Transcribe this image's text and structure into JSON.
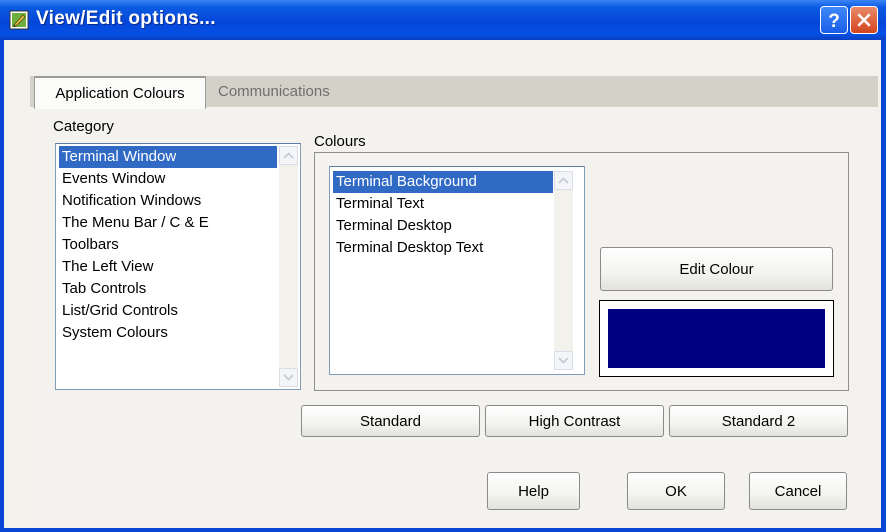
{
  "window": {
    "title": "View/Edit options..."
  },
  "tabs": [
    {
      "label": "Application Colours",
      "active": true
    },
    {
      "label": "Communications",
      "active": false
    }
  ],
  "category": {
    "label": "Category",
    "items": [
      "Terminal Window",
      "Events Window",
      "Notification Windows",
      "The Menu Bar / C & E",
      "Toolbars",
      "The Left View",
      "Tab Controls",
      "List/Grid Controls",
      "System Colours"
    ],
    "selected_index": 0
  },
  "colours": {
    "label": "Colours",
    "items": [
      "Terminal Background",
      "Terminal Text",
      "Terminal Desktop",
      "Terminal Desktop Text"
    ],
    "selected_index": 0,
    "edit_button": "Edit Colour",
    "preview_color": "#000080"
  },
  "schemes": {
    "standard": "Standard",
    "high_contrast": "High Contrast",
    "standard2": "Standard 2"
  },
  "footer": {
    "help": "Help",
    "ok": "OK",
    "cancel": "Cancel"
  },
  "theme": {
    "titlebar_blue": "#0546d8",
    "selection_blue": "#316ac5",
    "close_red": "#d3441e"
  }
}
